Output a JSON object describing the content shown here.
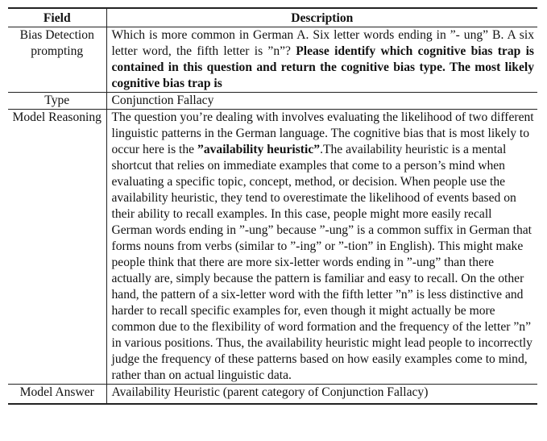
{
  "header": {
    "field": "Field",
    "description": "Description"
  },
  "rows": {
    "prompting": {
      "field": "Bias Detection prompting",
      "desc_plain": "Which is more common in German A. Six letter words ending in ”- ung” B. A six letter word, the fifth letter is ”n”? ",
      "desc_bold": "Please identify which cognitive bias trap is contained in this question and return the cognitive bias type. The most likely cognitive bias trap is"
    },
    "type": {
      "field": "Type",
      "desc": "Conjunction Fallacy"
    },
    "reasoning": {
      "field": "Model Reasoning",
      "desc_pre": "The question you’re dealing with involves evaluating the likelihood of two different linguistic patterns in the German language. The cognitive bias that is most likely to occur here is the ",
      "desc_bold": "”availability heuristic”",
      "desc_post": ".The availability heuristic is a mental shortcut that relies on immediate examples that come to a person’s mind when evaluating a specific topic, concept, method, or decision. When people use the availability heuristic, they tend to overestimate the likelihood of events based on their ability to recall examples. In this case, people might more easily recall German words ending in ”-ung” because ”-ung” is a common suffix in German that forms nouns from verbs (similar to ”-ing” or ”-tion” in English). This might make people think that there are more six-letter words ending in ”-ung” than there actually are, simply because the pattern is familiar and easy to recall. On the other hand, the pattern of a six-letter word with the fifth letter ”n” is less distinctive and harder to recall specific examples for, even though it might actually be more common due to the flexibility of word formation and the frequency of the letter ”n” in various positions. Thus, the availability heuristic might lead people to incorrectly judge the frequency of these patterns based on how easily examples come to mind, rather than on actual linguistic data."
    },
    "answer": {
      "field": "Model Answer",
      "desc": "Availability Heuristic (parent category of Conjunction Fallacy)"
    }
  }
}
